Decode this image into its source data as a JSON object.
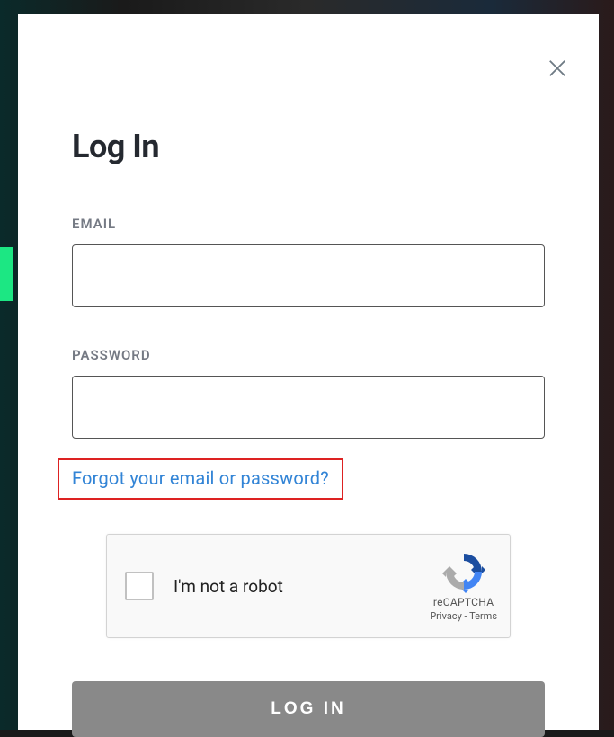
{
  "modal": {
    "title": "Log In",
    "email_label": "EMAIL",
    "email_value": "",
    "password_label": "PASSWORD",
    "password_value": "",
    "forgot_text": "Forgot your email or password?",
    "submit_label": "LOG IN"
  },
  "captcha": {
    "label": "I'm not a robot",
    "brand": "reCAPTCHA",
    "privacy": "Privacy",
    "terms": "Terms",
    "separator": " - "
  }
}
